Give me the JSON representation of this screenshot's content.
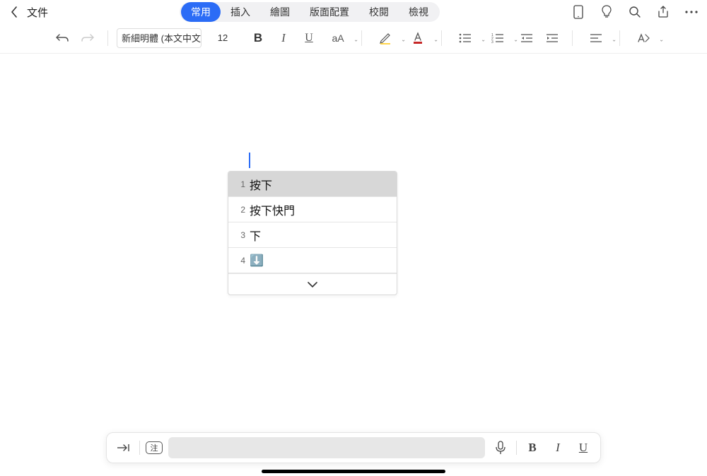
{
  "header": {
    "doc_title": "文件"
  },
  "tabs": {
    "items": [
      {
        "label": "常用",
        "active": true
      },
      {
        "label": "插入",
        "active": false
      },
      {
        "label": "繪圖",
        "active": false
      },
      {
        "label": "版面配置",
        "active": false
      },
      {
        "label": "校閱",
        "active": false
      },
      {
        "label": "檢視",
        "active": false
      }
    ]
  },
  "ribbon": {
    "font_name": "新細明體 (本文中文",
    "font_size": "12"
  },
  "candidates": {
    "items": [
      {
        "num": "1",
        "text": "按下",
        "selected": true,
        "emoji": ""
      },
      {
        "num": "2",
        "text": "按下快門",
        "selected": false,
        "emoji": ""
      },
      {
        "num": "3",
        "text": "下",
        "selected": false,
        "emoji": ""
      },
      {
        "num": "4",
        "text": "",
        "selected": false,
        "emoji": "⬇️"
      }
    ]
  },
  "bottombar": {
    "note_label": "注"
  }
}
